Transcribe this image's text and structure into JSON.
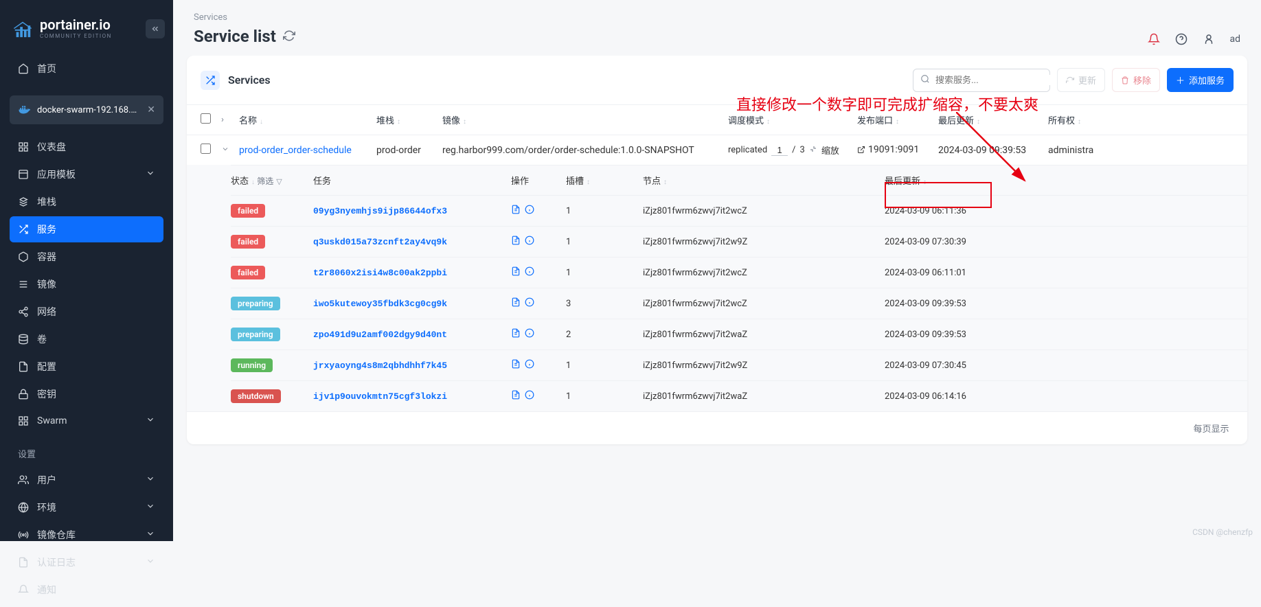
{
  "brand": {
    "name": "portainer.io",
    "edition": "COMMUNITY EDITION"
  },
  "sidebar": {
    "home": "首页",
    "env_pill": "docker-swarm-192.168.13...",
    "items": [
      {
        "icon": "dashboard",
        "label": "仪表盘"
      },
      {
        "icon": "template",
        "label": "应用模板",
        "chev": true
      },
      {
        "icon": "stack",
        "label": "堆栈"
      },
      {
        "icon": "service",
        "label": "服务",
        "active": true
      },
      {
        "icon": "container",
        "label": "容器"
      },
      {
        "icon": "image",
        "label": "镜像"
      },
      {
        "icon": "network",
        "label": "网络"
      },
      {
        "icon": "volume",
        "label": "卷"
      },
      {
        "icon": "config",
        "label": "配置"
      },
      {
        "icon": "secret",
        "label": "密钥"
      },
      {
        "icon": "swarm",
        "label": "Swarm",
        "chev": true
      }
    ],
    "settings_label": "设置",
    "settings": [
      {
        "icon": "users",
        "label": "用户",
        "chev": true
      },
      {
        "icon": "env",
        "label": "环境",
        "chev": true
      },
      {
        "icon": "registry",
        "label": "镜像仓库",
        "chev": true
      },
      {
        "icon": "auth",
        "label": "认证日志",
        "chev": true
      },
      {
        "icon": "notify",
        "label": "通知"
      }
    ]
  },
  "header": {
    "breadcrumb": "Services",
    "title": "Service list",
    "user": "ad"
  },
  "annotation": "直接修改一个数字即可完成扩缩容，不要太爽",
  "panel": {
    "title": "Services",
    "search_placeholder": "搜索服务...",
    "btn_update": "更新",
    "btn_remove": "移除",
    "btn_add": "添加服务"
  },
  "columns": {
    "name": "名称",
    "stack": "堆栈",
    "image": "镜像",
    "sched": "调度模式",
    "port": "发布端口",
    "upd": "最后更新",
    "own": "所有权"
  },
  "service": {
    "name": "prod-order_order-schedule",
    "stack": "prod-order",
    "image": "reg.harbor999.com/order/order-schedule:1.0.0-SNAPSHOT",
    "mode": "replicated",
    "current": "1",
    "target": "3",
    "scale": "缩放",
    "port": "19091:9091",
    "updated": "2024-03-09 09:39:53",
    "owner": "administra"
  },
  "subcols": {
    "status": "状态",
    "filter": "筛选",
    "task": "任务",
    "ops": "操作",
    "slot": "插槽",
    "node": "节点",
    "upd": "最后更新"
  },
  "tasks": [
    {
      "status": "failed",
      "id": "09yg3nyemhjs9ijp86644ofx3",
      "slot": "1",
      "node": "iZjz801fwrm6zwvj7it2wcZ",
      "upd": "2024-03-09 06:11:36"
    },
    {
      "status": "failed",
      "id": "q3uskd015a73zcnft2ay4vq9k",
      "slot": "1",
      "node": "iZjz801fwrm6zwvj7it2w9Z",
      "upd": "2024-03-09 07:30:39"
    },
    {
      "status": "failed",
      "id": "t2r8060x2isi4w8c00ak2ppbi",
      "slot": "1",
      "node": "iZjz801fwrm6zwvj7it2wcZ",
      "upd": "2024-03-09 06:11:01"
    },
    {
      "status": "preparing",
      "id": "iwo5kutewoy35fbdk3cg0cg9k",
      "slot": "3",
      "node": "iZjz801fwrm6zwvj7it2wcZ",
      "upd": "2024-03-09 09:39:53"
    },
    {
      "status": "preparing",
      "id": "zpo491d9u2amf002dgy9d40nt",
      "slot": "2",
      "node": "iZjz801fwrm6zwvj7it2waZ",
      "upd": "2024-03-09 09:39:53"
    },
    {
      "status": "running",
      "id": "jrxyaoyng4s8m2qbhdhhf7k45",
      "slot": "1",
      "node": "iZjz801fwrm6zwvj7it2w9Z",
      "upd": "2024-03-09 07:30:45"
    },
    {
      "status": "shutdown",
      "id": "ijv1p9ouvokmtn75cgf3lokzi",
      "slot": "1",
      "node": "iZjz801fwrm6zwvj7it2waZ",
      "upd": "2024-03-09 06:14:16"
    }
  ],
  "pager": "每页显示",
  "watermark": "CSDN @chenzfp"
}
